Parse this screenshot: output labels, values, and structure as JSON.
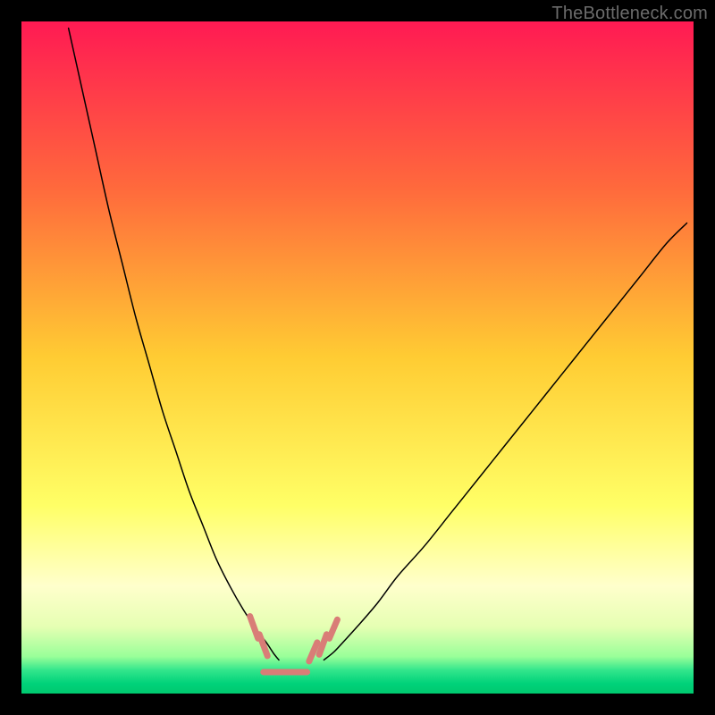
{
  "watermark": "TheBottleneck.com",
  "chart_data": {
    "type": "line",
    "title": "",
    "xlabel": "",
    "ylabel": "",
    "xlim": [
      0,
      100
    ],
    "ylim": [
      0,
      100
    ],
    "grid": false,
    "legend": false,
    "background_gradient": {
      "stops": [
        {
          "offset": 0.0,
          "color": "#ff1a53"
        },
        {
          "offset": 0.25,
          "color": "#ff6a3c"
        },
        {
          "offset": 0.5,
          "color": "#ffcc33"
        },
        {
          "offset": 0.72,
          "color": "#ffff66"
        },
        {
          "offset": 0.84,
          "color": "#ffffcc"
        },
        {
          "offset": 0.9,
          "color": "#e6ffb3"
        },
        {
          "offset": 0.945,
          "color": "#99ff99"
        },
        {
          "offset": 0.965,
          "color": "#33e68c"
        },
        {
          "offset": 0.985,
          "color": "#00d27a"
        },
        {
          "offset": 1.0,
          "color": "#00c96f"
        }
      ]
    },
    "series": [
      {
        "name": "left-curve",
        "stroke": "#000000",
        "stroke_width": 1.5,
        "x": [
          7,
          9,
          11,
          13,
          15,
          17,
          19,
          21,
          23,
          25,
          27,
          29,
          31,
          33,
          35,
          36.5,
          37.5,
          38.3
        ],
        "y": [
          99,
          90,
          81,
          72,
          64,
          56,
          49,
          42,
          36,
          30,
          25,
          20,
          16,
          12.5,
          9.5,
          7.5,
          6,
          5
        ]
      },
      {
        "name": "right-curve",
        "stroke": "#000000",
        "stroke_width": 1.5,
        "x": [
          45,
          46.5,
          48,
          50,
          53,
          56,
          60,
          64,
          68,
          72,
          76,
          80,
          84,
          88,
          92,
          96,
          99
        ],
        "y": [
          5,
          6.2,
          7.8,
          10,
          13.5,
          17.5,
          22,
          27,
          32,
          37,
          42,
          47,
          52,
          57,
          62,
          67,
          70
        ]
      },
      {
        "name": "floor-markers",
        "stroke": "#d97d77",
        "stroke_width": 7,
        "segments": [
          {
            "x": [
              34.0,
              35.2
            ],
            "y": [
              11.5,
              8.2
            ]
          },
          {
            "x": [
              35.4,
              36.6
            ],
            "y": [
              8.8,
              5.6
            ]
          },
          {
            "x": [
              36.0,
              42.5
            ],
            "y": [
              3.2,
              3.2
            ]
          },
          {
            "x": [
              42.8,
              44.0
            ],
            "y": [
              4.8,
              7.6
            ]
          },
          {
            "x": [
              44.3,
              45.4
            ],
            "y": [
              5.8,
              8.8
            ]
          },
          {
            "x": [
              45.8,
              47.0
            ],
            "y": [
              8.2,
              11.0
            ]
          }
        ]
      }
    ]
  }
}
